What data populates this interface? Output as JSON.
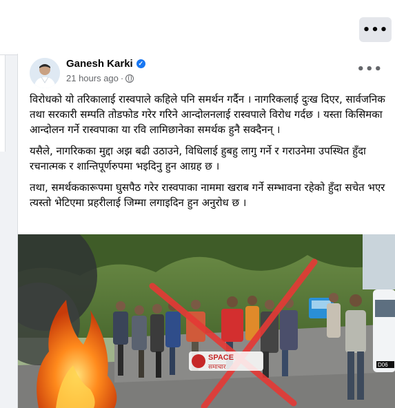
{
  "top_card": {
    "more_label": "•••"
  },
  "post": {
    "author": "Ganesh Karki",
    "verified_icon": "verified-badge-icon",
    "time": "21 hours ago",
    "dot": "·",
    "privacy_icon": "globe-icon",
    "more_label": "•••",
    "paragraphs": [
      "विरोधको यो तरिकालाई रास्वपाले कहिले पनि समर्थन गर्दैन । नागरिकलाई दुःख दिएर, सार्वजनिक तथा सरकारी सम्पति तोडफोड गरेर गरिने आन्दोलनलाई रास्वपाले विरोध गर्दछ । यस्ता किसिमका आन्दोलन गर्ने रास्वपाका या रवि लामिछानेका समर्थक हुनै सक्दैनन् ।",
      "यसैले, नागरिकका मुद्दा अझ बढी उठाउने, विधिलाई हुबहु लागु गर्ने र गराउनेमा उपस्थित हुँदा रचनात्मक र शान्तिपूर्णरुपमा भइदिनु हुन आग्रह छ ।",
      "तथा, समर्थककारूपमा घुसपैठ गरेर रास्वपाका नाममा खराब गर्ने सम्भावना रहेको हुँदा सचेत भएर त्यस्तो भेटिएमा प्रहरीलाई जिम्मा लगाइदिन हुन अनुरोध छ ।"
    ],
    "photo": {
      "watermark_line1": "SPACE",
      "watermark_line2": "समाचार",
      "van_plate": "D06"
    }
  },
  "colors": {
    "accent": "#1877f2",
    "cross": "#e53935",
    "bg": "#f0f2f5"
  }
}
